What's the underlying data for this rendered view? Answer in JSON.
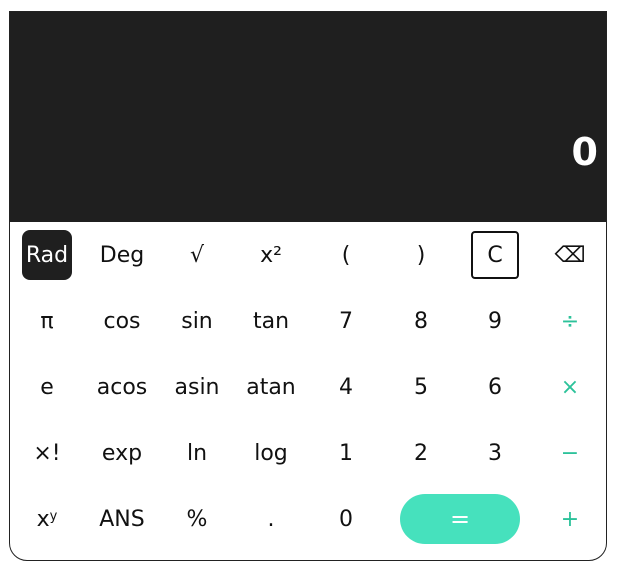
{
  "display": {
    "value": "0"
  },
  "keys": [
    [
      "Rad",
      "Deg",
      "√",
      "x²",
      "(",
      ")",
      "C",
      "⌫"
    ],
    [
      "π",
      "cos",
      "sin",
      "tan",
      "7",
      "8",
      "9",
      "÷"
    ],
    [
      "e",
      "acos",
      "asin",
      "atan",
      "4",
      "5",
      "6",
      "×"
    ],
    [
      "×!",
      "exp",
      "ln",
      "log",
      "1",
      "2",
      "3",
      "−"
    ],
    [
      "x",
      "ANS",
      "%",
      ".",
      "0",
      "=",
      "+"
    ]
  ],
  "power_key": {
    "base": "x",
    "exp": "y"
  },
  "colors": {
    "display_bg": "#1f1f1f",
    "accent": "#46e1bd",
    "operator": "#2cc29a"
  }
}
